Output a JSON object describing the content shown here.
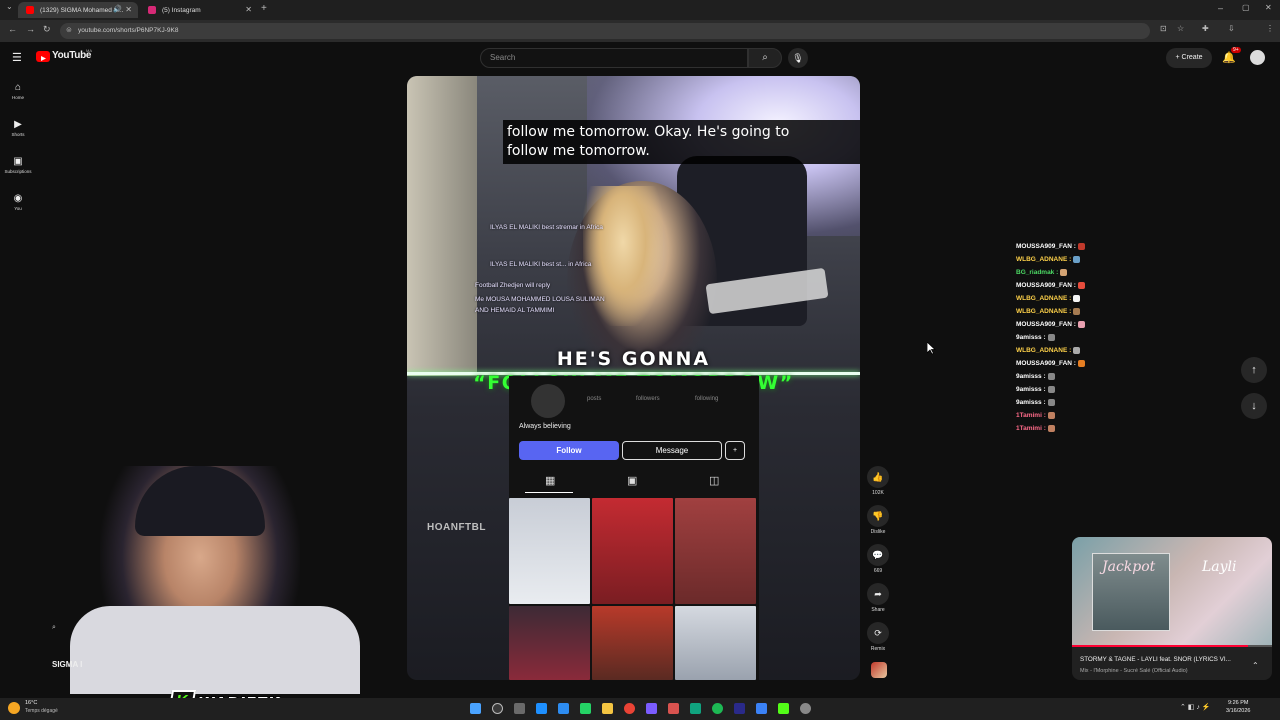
{
  "browser": {
    "tabs": [
      {
        "title": "(1329) SIGMA Mohamed S...",
        "active": true,
        "favicon_color": "#ff0000"
      },
      {
        "title": "(5) Instagram",
        "active": false,
        "favicon_color": "#d62976"
      }
    ],
    "new_tab_glyph": "+",
    "url": "youtube.com/shorts/P6NP7KJ-9K8"
  },
  "youtube": {
    "logo_text": "YouTube",
    "country_code": "MA",
    "search_placeholder": "Search",
    "create_label": "Create",
    "notification_count": "9+",
    "sidebar": [
      {
        "label": "Home",
        "icon": "home-icon",
        "glyph": "⌂"
      },
      {
        "label": "Shorts",
        "icon": "shorts-icon",
        "glyph": "▶"
      },
      {
        "label": "Subscriptions",
        "icon": "subscriptions-icon",
        "glyph": "▣"
      },
      {
        "label": "You",
        "icon": "you-icon",
        "glyph": "◉"
      }
    ]
  },
  "video": {
    "caption_line1": "follow me tomorrow. Okay. He's going to",
    "caption_line2": "follow me tomorrow.",
    "overlay_title_1": "HE'S GONNA",
    "overlay_title_2": "“FOLLOW ME TOMORROW”",
    "watermark": "HOANFTBL",
    "stream_chat": [
      "ILYAS EL MALIKI best stremar in Africa",
      "ILYAS EL MALIKI best st... in Africa",
      "Football  Zhedjen  will reply",
      "Me MOUSA MOHAMMED  LOUSA SULIMAN",
      "AND HEMAID AL TAMMIMI"
    ],
    "instagram": {
      "stats_labels": [
        "posts",
        "followers",
        "following"
      ],
      "bio": "Always believing",
      "follow_label": "Follow",
      "message_label": "Message",
      "add_glyph": "+",
      "thumb_colors": [
        "#d9dde4",
        "#b8252e",
        "#8a2a2a",
        "#6b3a4a",
        "#b33a2a",
        "#c7ccd4"
      ]
    }
  },
  "actions": [
    {
      "icon": "like-icon",
      "glyph": "👍",
      "label": "102K"
    },
    {
      "icon": "dislike-icon",
      "glyph": "👎",
      "label": "Dislike"
    },
    {
      "icon": "comment-icon",
      "glyph": "💬",
      "label": "669"
    },
    {
      "icon": "share-icon",
      "glyph": "➦",
      "label": "Share"
    },
    {
      "icon": "remix-icon",
      "glyph": "⟳",
      "label": "Remix"
    }
  ],
  "overlay_chat": [
    {
      "user": "MOUSSA909_FAN :",
      "color": "#ffffff",
      "emote": "#c0392b"
    },
    {
      "user": "WLBG_ADNANE :",
      "color": "#ffd24a",
      "emote": "#6aa0c8"
    },
    {
      "user": "BG_riadmak :",
      "color": "#4cd964",
      "emote": "#d4a373"
    },
    {
      "user": "MOUSSA909_FAN :",
      "color": "#ffffff",
      "emote": "#e74c3c"
    },
    {
      "user": "WLBG_ADNANE :",
      "color": "#ffd24a",
      "emote": "#f5f5f5"
    },
    {
      "user": "WLBG_ADNANE :",
      "color": "#ffd24a",
      "emote": "#a67c52"
    },
    {
      "user": "MOUSSA909_FAN :",
      "color": "#ffffff",
      "emote": "#e8a0b0"
    },
    {
      "user": "9amisss :",
      "color": "#ffffff",
      "emote": "#888888"
    },
    {
      "user": "WLBG_ADNANE :",
      "color": "#ffd24a",
      "emote": "#aaaaaa"
    },
    {
      "user": "MOUSSA909_FAN :",
      "color": "#ffffff",
      "emote": "#e67e22"
    },
    {
      "user": "9amisss :",
      "color": "#ffffff",
      "emote": "#888888"
    },
    {
      "user": "9amisss :",
      "color": "#ffffff",
      "emote": "#888888"
    },
    {
      "user": "9amisss :",
      "color": "#ffffff",
      "emote": "#888888"
    },
    {
      "user": "1Tamimi :",
      "color": "#ff6b8a",
      "emote": "#c08060"
    },
    {
      "user": "1Tamimi :",
      "color": "#ff6b8a",
      "emote": "#c08060"
    }
  ],
  "miniplayer": {
    "title": "STORMY & TAGNE - LAYLI feat. SNOR (LYRICS VI...",
    "subtitle": "Mix - l'Morphine - Sucré Salé (Official Audio)",
    "art_text_1": "Jackpot",
    "art_text_2": "Layli"
  },
  "streamer": {
    "badge_text": "WADIEZK",
    "badge_letter": "K",
    "side_label": "SIGMA I"
  },
  "taskbar": {
    "weather_temp": "16°C",
    "weather_desc": "Temps dégagé",
    "time": "9:26 PM",
    "date": "3/16/2026"
  }
}
